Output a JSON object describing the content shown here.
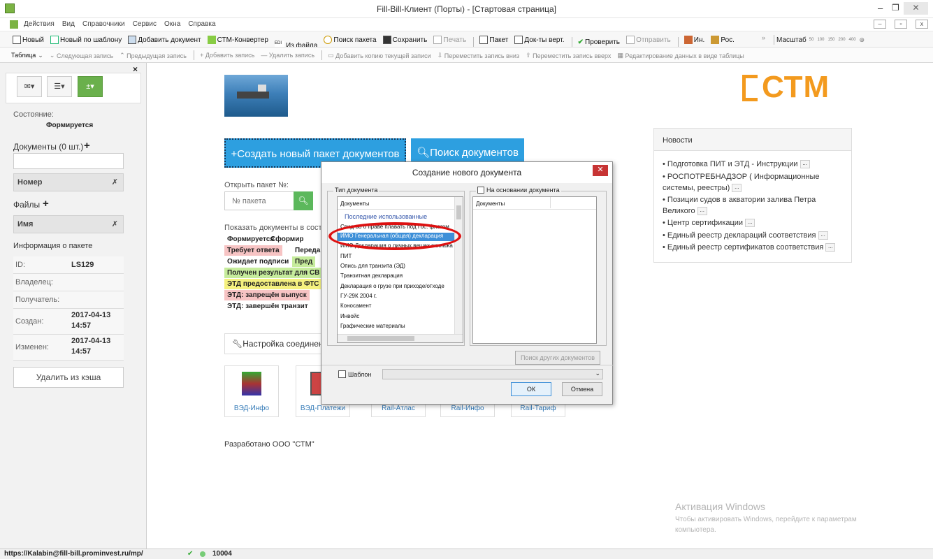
{
  "window": {
    "title": "Fill-Bill-Клиент (Порты) - [Стартовая страница]"
  },
  "menu": [
    "Действия",
    "Вид",
    "Справочники",
    "Сервис",
    "Окна",
    "Справка"
  ],
  "toolbar": {
    "new": "Новый",
    "new_template": "Новый по шаблону",
    "add_document": "Добавить документ",
    "converter": "СТМ-Конвертер",
    "from_file": "Из файла",
    "search_packet": "Поиск пакета",
    "save": "Сохранить",
    "print": "Печать",
    "packet": "Пакет",
    "docs_vert": "Док-ты верт.",
    "check": "Проверить",
    "send": "Отправить",
    "in": "Ин.",
    "ros": "Рос.",
    "scale_label": "Масштаб",
    "scales": [
      "50",
      "100",
      "150",
      "200",
      "400"
    ]
  },
  "toolbar2": {
    "table": "Таблица",
    "next": "Следующая запись",
    "prev": "Предыдущая запись",
    "add": "Добавить запись",
    "delete": "Удалить запись",
    "copy": "Добавить копию текущей записи",
    "move_down": "Переместить запись вниз",
    "move_up": "Переместить запись вверх",
    "edit_table": "Редактирование данных в виде таблицы"
  },
  "sidebar": {
    "state_label": "Состояние:",
    "state_value": "Формируется",
    "documents_label": "Документы (0 шт.)",
    "number_col": "Номер",
    "files_label": "Файлы",
    "name_col": "Имя",
    "info_title": "Информация о пакете",
    "info": {
      "id_k": "ID:",
      "id_v": "LS129",
      "owner_k": "Владелец:",
      "receiver_k": "Получатель:",
      "created_k": "Создан:",
      "created_v1": "2017-04-13",
      "created_v2": "14:57",
      "modified_k": "Изменен:",
      "modified_v1": "2017-04-13",
      "modified_v2": "14:57"
    },
    "delete_cache": "Удалить из кэша"
  },
  "main": {
    "create_btn": "Создать новый пакет документов",
    "search_btn": "Поиск документов",
    "open_label": "Открыть пакет №:",
    "packet_placeholder": "№ пакета",
    "show_label": "Показать документы в сост",
    "statuses": {
      "s1": "Формируется",
      "s2": "Сформир",
      "s3": "Требует ответа",
      "s4": "Переда",
      "s5": "Ожидает подписи",
      "s6": "Пред",
      "s7": "Получен результат для СВ",
      "s8": "ЭТД предоставлена в ФТС",
      "s9": "ЭТД: запрещён выпуск",
      "s10": "ЭТД: завершён транзит"
    },
    "settings_btn": "Настройка соединения",
    "tiles": [
      "ВЭД-Инфо",
      "ВЭД-Платежи",
      "Rail-Атлас",
      "Rail-Инфо",
      "Rail-Тариф"
    ],
    "developed": "Разработано ООО \"СТМ\"",
    "logo": "СТМ"
  },
  "news": {
    "title": "Новости",
    "items": [
      "• Подготовка ПИТ и ЭТД - Инструкции",
      "• РОСПОТРЕБНАДЗОР ( Информационные",
      "системы, реестры)",
      "• Позиции судов в акватории залива Петра",
      "Великого",
      "• Центр сертификации",
      "• Единый реестр деклараций соответствия",
      "• Единый реестр сертификатов соответствия"
    ],
    "more": "..."
  },
  "dialog": {
    "title": "Создание нового документа",
    "type_legend": "Тип документа",
    "base_legend": "На основании документа",
    "list_header": "Документы",
    "right_header": "Документы",
    "items": [
      "Последние использованные",
      "Свид-во о праве плавать под Гос. флагом",
      "ИМО Генеральная (общая) декларация",
      "ИМО Декларация о личных вещах экипажа",
      "ПИТ",
      "Опись для транзита (ЭД)",
      "Транзитная декларация",
      "Декларация о грузе при приходе/отходе",
      "ГУ-29К 2004 г.",
      "Коносамент",
      "Инвойс",
      "Графические материалы"
    ],
    "search_other": "Поиск других документов",
    "template": "Шаблон",
    "ok": "ОК",
    "cancel": "Отмена"
  },
  "statusbar": {
    "url": "https://Kalabin@fill-bill.prominvest.ru/mp/",
    "count": "10004"
  },
  "watermark": {
    "line1": "Активация Windows",
    "line2": "Чтобы активировать Windows, перейдите к параметрам",
    "line3": "компьютера."
  }
}
